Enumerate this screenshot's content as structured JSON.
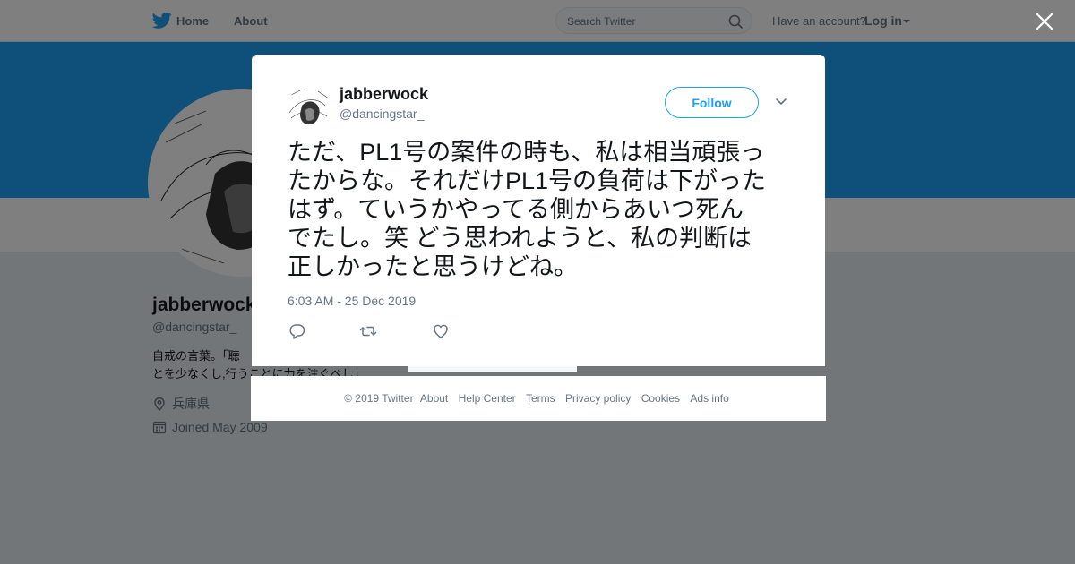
{
  "topnav": {
    "home_label": "Home",
    "about_label": "About",
    "search_placeholder": "Search Twitter",
    "account_prompt": "Have an account?",
    "login_label": "Log in"
  },
  "profile": {
    "name": "jabberwock",
    "handle": "@dancingstar_",
    "bio_lines": [
      "自戒の言葉。「聴",
      "とを少なくし,行うことに力を注ぐべし」"
    ],
    "location": "兵庫県",
    "joined": "Joined May 2009"
  },
  "colors": {
    "brand": "#1da1f2",
    "text": "#14171a",
    "muted": "#657786"
  },
  "tweet": {
    "author_name": "jabberwock",
    "author_handle": "@dancingstar_",
    "follow_label": "Follow",
    "text_lines": [
      "ただ、PL1号の案件の時も、私は相当頑張っ",
      "たからな。それだけPL1号の負荷は下がった",
      "はず。ていうかやってる側からあいつ死ん",
      "でたし。笑 どう思われようと、私の判断は",
      "正しかったと思うけどね。"
    ],
    "timestamp": "6:03 AM - 25 Dec 2019",
    "icons": [
      "reply-icon",
      "retweet-icon",
      "like-icon"
    ]
  },
  "footer": {
    "copyright": "© 2019 Twitter",
    "links": [
      "About",
      "Help Center",
      "Terms",
      "Privacy policy",
      "Cookies",
      "Ads info"
    ]
  }
}
